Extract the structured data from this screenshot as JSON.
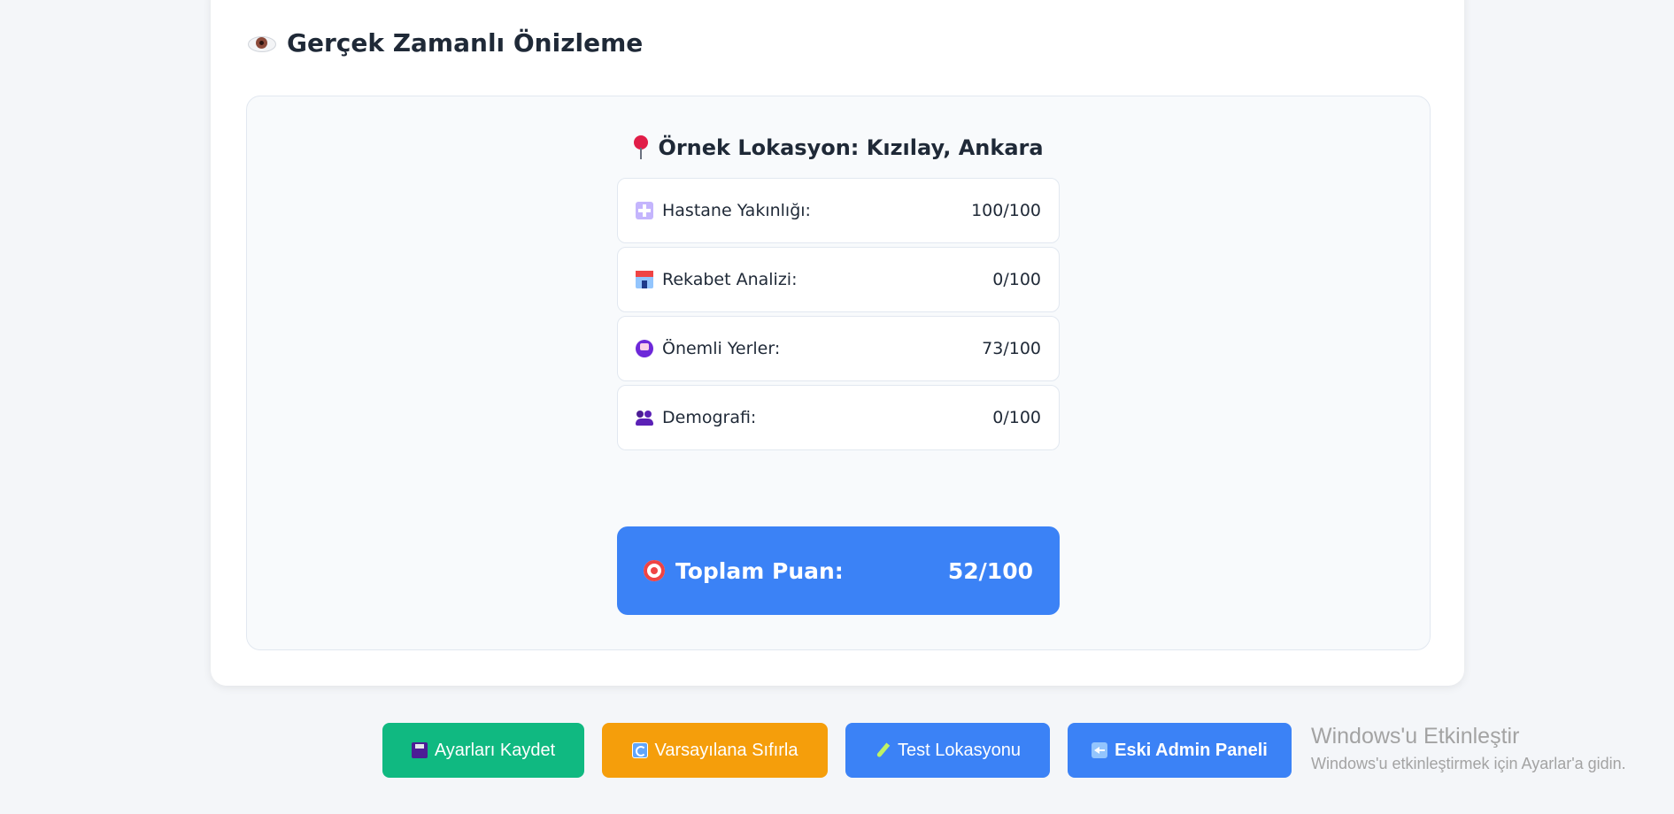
{
  "preview": {
    "title": "Gerçek Zamanlı Önizleme",
    "title_icon": "eye-icon",
    "location_label": "Örnek Lokasyon: Kızılay, Ankara",
    "location_icon": "pin-icon",
    "scores": [
      {
        "icon": "hospital-icon",
        "label": "Hastane Yakınlığı:",
        "value": "100/100"
      },
      {
        "icon": "store-icon",
        "label": "Rekabet Analizi:",
        "value": "0/100"
      },
      {
        "icon": "metro-icon",
        "label": "Önemli Yerler:",
        "value": "73/100"
      },
      {
        "icon": "people-icon",
        "label": "Demografi:",
        "value": "0/100"
      }
    ],
    "total": {
      "icon": "target-icon",
      "label": "Toplam Puan:",
      "value": "52/100"
    }
  },
  "actions": {
    "save": "Ayarları Kaydet",
    "reset": "Varsayılana Sıfırla",
    "test": "Test Lokasyonu",
    "old_panel": "Eski Admin Paneli"
  },
  "watermark": {
    "line1": "Windows'u Etkinleştir",
    "line2": "Windows'u etkinleştirmek için Ayarlar'a gidin."
  },
  "colors": {
    "save": "#10b981",
    "reset": "#f59e0b",
    "primary": "#3b82f6"
  }
}
